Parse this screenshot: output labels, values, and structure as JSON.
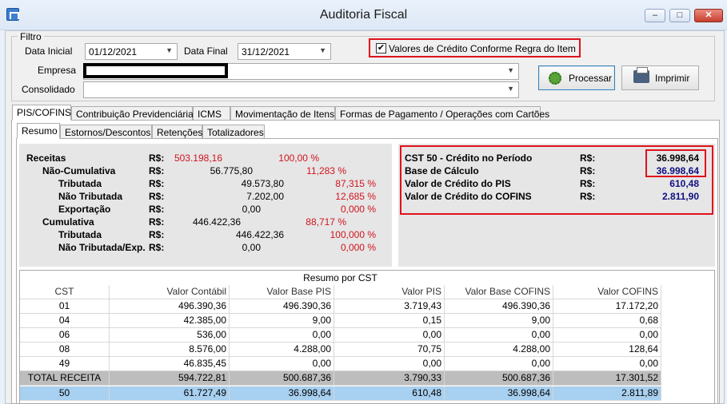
{
  "window": {
    "title": "Auditoria Fiscal",
    "min": "–",
    "max": "□",
    "close": "✕"
  },
  "filtro": {
    "legend": "Filtro",
    "data_inicial_label": "Data Inicial",
    "data_inicial": "01/12/2021",
    "data_final_label": "Data Final",
    "data_final": "31/12/2021",
    "checkbox_label": "Valores de Crédito Conforme Regra do Item",
    "checkbox_checked": "✔",
    "empresa_label": "Empresa",
    "consolidado_label": "Consolidado",
    "processar_label": "Processar",
    "imprimir_label": "Imprimir"
  },
  "tabs": [
    "PIS/COFINS",
    "Contribuição Previdenciária",
    "ICMS",
    "Movimentação de Itens",
    "Formas de Pagamento / Operações com Cartões"
  ],
  "subtabs": [
    "Resumo",
    "Estornos/Descontos",
    "Retenções",
    "Totalizadores"
  ],
  "currency": "R$:",
  "resumo_left": [
    {
      "label": "Receitas",
      "value": "503.198,16",
      "pct": "100,00 %"
    },
    {
      "label": "Não-Cumulativa",
      "value": "56.775,80",
      "pct": "11,283 %"
    },
    {
      "label": "Tributada",
      "value": "49.573,80",
      "pct": "87,315 %"
    },
    {
      "label": "Não Tributada",
      "value": "7.202,00",
      "pct": "12,685 %"
    },
    {
      "label": "Exportação",
      "value": "0,00",
      "pct": "0,000 %"
    },
    {
      "label": "Cumulativa",
      "value": "446.422,36",
      "pct": "88,717 %"
    },
    {
      "label": "Tributada",
      "value": "446.422,36",
      "pct": "100,000 %"
    },
    {
      "label": "Não Tributada/Exp.",
      "value": "0,00",
      "pct": "0,000 %"
    }
  ],
  "resumo_right": [
    {
      "label": "CST 50 - Crédito no Período",
      "value": "36.998,64"
    },
    {
      "label": "Base de Cálculo",
      "value": "36.998,64"
    },
    {
      "label": "Valor de Crédito do PIS",
      "value": "610,48"
    },
    {
      "label": "Valor de Crédito do COFINS",
      "value": "2.811,90"
    }
  ],
  "grid": {
    "title": "Resumo por CST",
    "columns": [
      "CST",
      "Valor Contábil",
      "Valor Base PIS",
      "Valor PIS",
      "Valor Base COFINS",
      "Valor COFINS"
    ],
    "rows": [
      [
        "01",
        "496.390,36",
        "496.390,36",
        "3.719,43",
        "496.390,36",
        "17.172,20"
      ],
      [
        "04",
        "42.385,00",
        "9,00",
        "0,15",
        "9,00",
        "0,68"
      ],
      [
        "06",
        "536,00",
        "0,00",
        "0,00",
        "0,00",
        "0,00"
      ],
      [
        "08",
        "8.576,00",
        "4.288,00",
        "70,75",
        "4.288,00",
        "128,64"
      ],
      [
        "49",
        "46.835,45",
        "0,00",
        "0,00",
        "0,00",
        "0,00"
      ],
      [
        "TOTAL RECEITA",
        "594.722,81",
        "500.687,36",
        "3.790,33",
        "500.687,36",
        "17.301,52"
      ],
      [
        "50",
        "61.727,49",
        "36.998,64",
        "610,48",
        "36.998,64",
        "2.811,89"
      ]
    ]
  }
}
